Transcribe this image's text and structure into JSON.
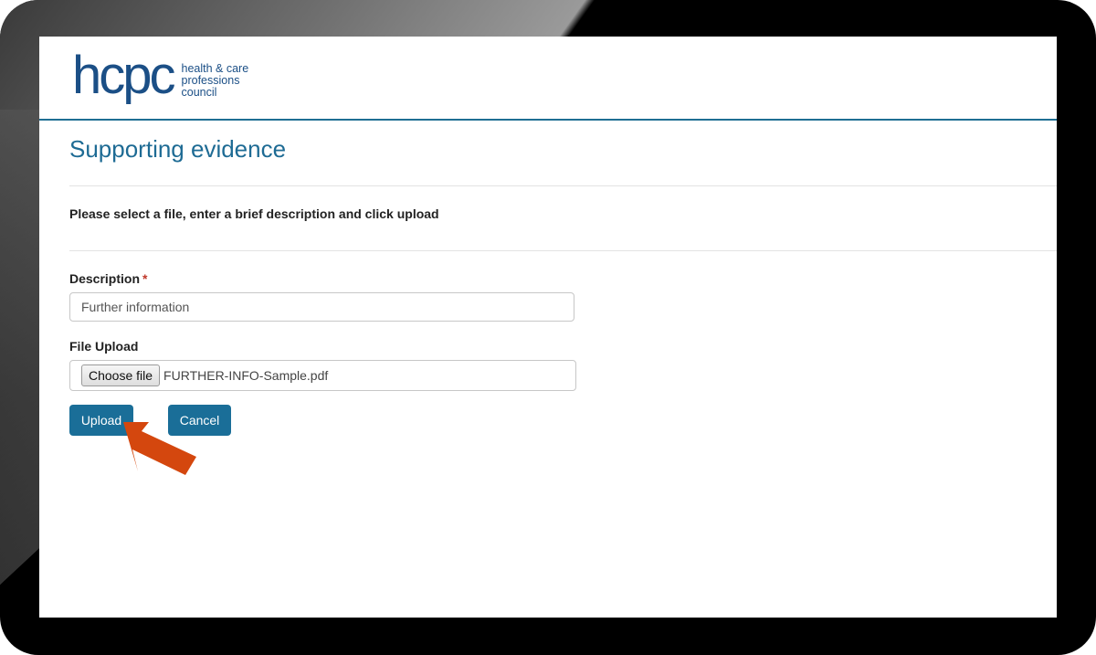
{
  "header": {
    "logo_mark": "hcpc",
    "logo_line1": "health & care",
    "logo_line2": "professions",
    "logo_line3": "council"
  },
  "page": {
    "title": "Supporting evidence",
    "instructions": "Please select a file, enter a brief description and click upload"
  },
  "form": {
    "description_label": "Description",
    "required_marker": "*",
    "description_value": "Further information",
    "file_upload_label": "File Upload",
    "choose_file_label": "Choose file",
    "file_name": "FURTHER-INFO-Sample.pdf",
    "upload_label": "Upload",
    "cancel_label": "Cancel"
  },
  "colors": {
    "brand": "#1b4f86",
    "button": "#1a6e98",
    "callout_arrow": "#d4470e"
  },
  "annotation": {
    "arrow_icon": "pointer-arrow-icon"
  }
}
